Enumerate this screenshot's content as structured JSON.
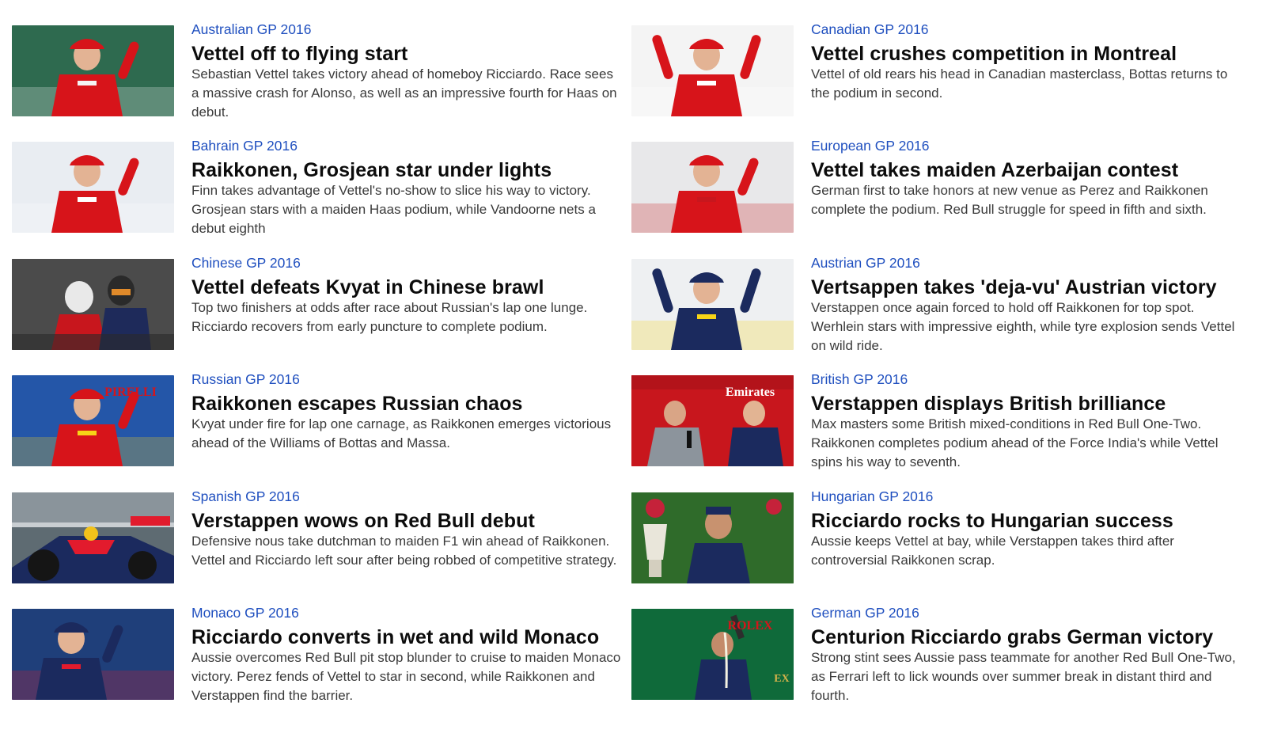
{
  "articles_left": [
    {
      "kicker": "Australian GP 2016",
      "headline": "Vettel off to flying start",
      "summary": "Sebastian Vettel takes victory ahead of homeboy Ricciardo. Race sees a massive crash for Alonso, as well as an impressive fourth for Haas on debut.",
      "thumb_icon": "driver-podium-photo",
      "thumb_colors": {
        "bg": "#2e6a4f",
        "suit": "#d7141a",
        "accent": "#f4f4f4"
      }
    },
    {
      "kicker": "Bahrain GP 2016",
      "headline": "Raikkonen, Grosjean star under lights",
      "summary": "Finn takes advantage of Vettel's no-show to slice his way to victory. Grosjean stars with a maiden Haas podium, while Vandoorne nets a debut eighth",
      "thumb_icon": "driver-podium-photo",
      "thumb_colors": {
        "bg": "#e9edf2",
        "suit": "#d7141a",
        "accent": "#ffffff"
      }
    },
    {
      "kicker": "Chinese GP 2016",
      "headline": "Vettel defeats Kvyat in Chinese brawl",
      "summary": "Top two finishers at odds after race about Russian's lap one lunge. Ricciardo recovers from early puncture to complete podium.",
      "thumb_icon": "two-drivers-photo",
      "thumb_colors": {
        "bg": "#3b3b3b",
        "suit": "#c8161d",
        "accent": "#1e2a5a"
      }
    },
    {
      "kicker": "Russian GP 2016",
      "headline": "Raikkonen escapes Russian chaos",
      "summary": "Kvyat under fire for lap one carnage, as Raikkonen emerges victorious ahead of the Williams of Bottas and Massa.",
      "thumb_icon": "driver-podium-photo",
      "thumb_colors": {
        "bg": "#2456a8",
        "suit": "#d7141a",
        "accent": "#f7d417"
      }
    },
    {
      "kicker": "Spanish GP 2016",
      "headline": "Verstappen wows on Red Bull debut",
      "summary": "Defensive nous take dutchman to maiden F1 win ahead of Raikkonen. Vettel and Ricciardo left sour after being robbed of competitive strategy.",
      "thumb_icon": "race-car-photo",
      "thumb_colors": {
        "bg": "#5e6b72",
        "suit": "#1b2a5e",
        "accent": "#e21b2d"
      }
    },
    {
      "kicker": "Monaco GP 2016",
      "headline": "Ricciardo converts in wet and wild Monaco",
      "summary": "Aussie overcomes Red Bull pit stop blunder to cruise to maiden Monaco victory. Perez fends of Vettel to star in second, while Raikkonen and Verstappen find the barrier.",
      "thumb_icon": "driver-portrait-photo",
      "thumb_colors": {
        "bg": "#1f3f7a",
        "suit": "#1b2a5e",
        "accent": "#e21b2d"
      }
    }
  ],
  "articles_right": [
    {
      "kicker": "Canadian GP 2016",
      "headline": "Vettel crushes competition in Montreal",
      "summary": "Vettel of old rears his head in Canadian masterclass, Bottas returns to the podium in second.",
      "thumb_icon": "driver-celebrating-photo",
      "thumb_colors": {
        "bg": "#f4f4f4",
        "suit": "#d7141a",
        "accent": "#ffffff"
      }
    },
    {
      "kicker": "European GP 2016",
      "headline": "Vettel takes maiden Azerbaijan contest",
      "summary": "German first to take honors at new venue as Perez and Raikkonen complete the podium. Red Bull struggle for speed in fifth and sixth.",
      "thumb_icon": "driver-podium-photo",
      "thumb_colors": {
        "bg": "#e8e8ea",
        "suit": "#d7141a",
        "accent": "#c8161d"
      }
    },
    {
      "kicker": "Austrian GP 2016",
      "headline": "Vertsappen takes 'deja-vu' Austrian victory",
      "summary": "Verstappen once again forced to hold off Raikkonen for top spot. Werhlein stars with impressive eighth, while tyre explosion sends Vettel on wild ride.",
      "thumb_icon": "driver-celebrating-photo",
      "thumb_colors": {
        "bg": "#eef0f2",
        "suit": "#1b2a5e",
        "accent": "#f7d417"
      }
    },
    {
      "kicker": "British GP 2016",
      "headline": "Verstappen displays British brilliance",
      "summary": "Max masters some British mixed-conditions in Red Bull One-Two. Raikkonen completes podium ahead of the Force India's while Vettel spins his way to seventh.",
      "thumb_icon": "interview-photo",
      "thumb_colors": {
        "bg": "#c8161d",
        "suit": "#1b2a5e",
        "accent": "#ffffff"
      }
    },
    {
      "kicker": "Hungarian GP 2016",
      "headline": "Ricciardo rocks to Hungarian success",
      "summary": "Aussie keeps Vettel at bay, while Verstappen takes third after controversial Raikkonen scrap.",
      "thumb_icon": "driver-trophy-photo",
      "thumb_colors": {
        "bg": "#2f6b2a",
        "suit": "#1b2a5e",
        "accent": "#e9e6da"
      }
    },
    {
      "kicker": "German GP 2016",
      "headline": "Centurion Ricciardo grabs German victory",
      "summary": "Strong stint sees Aussie pass teammate for another Red Bull One-Two, as Ferrari left to lick wounds over summer break in distant third and fourth.",
      "thumb_icon": "driver-champagne-photo",
      "thumb_colors": {
        "bg": "#0f6a3a",
        "suit": "#1b2a5e",
        "accent": "#d4b24a"
      }
    }
  ],
  "thumb_logos": {
    "left_3": "PIRELLI",
    "right_3": "Emirates",
    "right_5": "ROLEX",
    "right_5_b": "EX"
  }
}
